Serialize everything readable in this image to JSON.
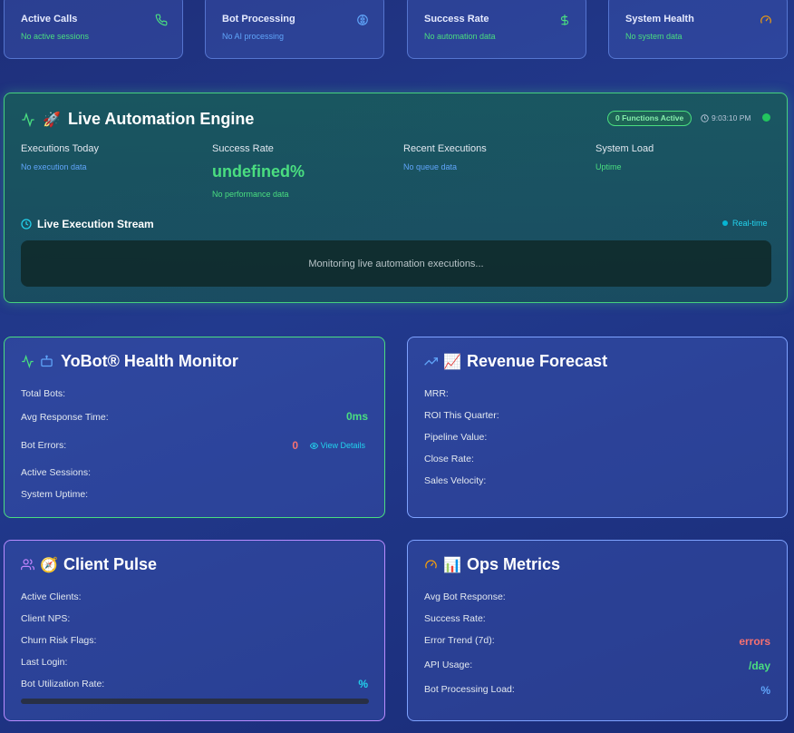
{
  "stats": [
    {
      "title": "Active Calls",
      "sub": "No active sessions",
      "icon": "phone-icon",
      "color": "#4ade80"
    },
    {
      "title": "Bot Processing",
      "sub": "No AI processing",
      "icon": "brain-icon",
      "color": "#60a5fa"
    },
    {
      "title": "Success Rate",
      "sub": "No automation data",
      "icon": "dollar-icon",
      "color": "#4ade80"
    },
    {
      "title": "System Health",
      "sub": "No system data",
      "icon": "gauge-icon",
      "color": "#4ade80"
    }
  ],
  "engine": {
    "title": "Live Automation Engine",
    "functions_badge": "0 Functions Active",
    "time": "9:03:10 PM",
    "metrics": [
      {
        "label": "Executions Today",
        "sub": "No execution data"
      },
      {
        "label": "Success Rate",
        "value": "undefined%",
        "sub": "No performance data"
      },
      {
        "label": "Recent Executions",
        "sub": "No queue data"
      },
      {
        "label": "System Load",
        "sub": "Uptime"
      }
    ],
    "stream_title": "Live Execution Stream",
    "realtime_label": "Real-time",
    "stream_message": "Monitoring live automation executions..."
  },
  "health": {
    "title": "YoBot® Health Monitor",
    "rows": [
      {
        "label": "Total Bots:",
        "value": ""
      },
      {
        "label": "Avg Response Time:",
        "value": "0ms"
      },
      {
        "label": "Bot Errors:",
        "value": "0"
      },
      {
        "label": "Active Sessions:",
        "value": ""
      },
      {
        "label": "System Uptime:",
        "value": ""
      }
    ],
    "view_details": "View Details"
  },
  "revenue": {
    "title": "Revenue Forecast",
    "rows": [
      {
        "label": "MRR:"
      },
      {
        "label": "ROI This Quarter:"
      },
      {
        "label": "Pipeline Value:"
      },
      {
        "label": "Close Rate:"
      },
      {
        "label": "Sales Velocity:"
      }
    ]
  },
  "client": {
    "title": "Client Pulse",
    "rows": [
      {
        "label": "Active Clients:",
        "value": ""
      },
      {
        "label": "Client NPS:",
        "value": ""
      },
      {
        "label": "Churn Risk Flags:",
        "value": ""
      },
      {
        "label": "Last Login:",
        "value": ""
      },
      {
        "label": "Bot Utilization Rate:",
        "value": "%"
      }
    ],
    "utilization": 0
  },
  "ops": {
    "title": "Ops Metrics",
    "rows": [
      {
        "label": "Avg Bot Response:",
        "value": ""
      },
      {
        "label": "Success Rate:",
        "value": ""
      },
      {
        "label": "Error Trend (7d):",
        "value": "errors"
      },
      {
        "label": "API Usage:",
        "value": "/day"
      },
      {
        "label": "Bot Processing Load:",
        "value": "%"
      }
    ]
  }
}
